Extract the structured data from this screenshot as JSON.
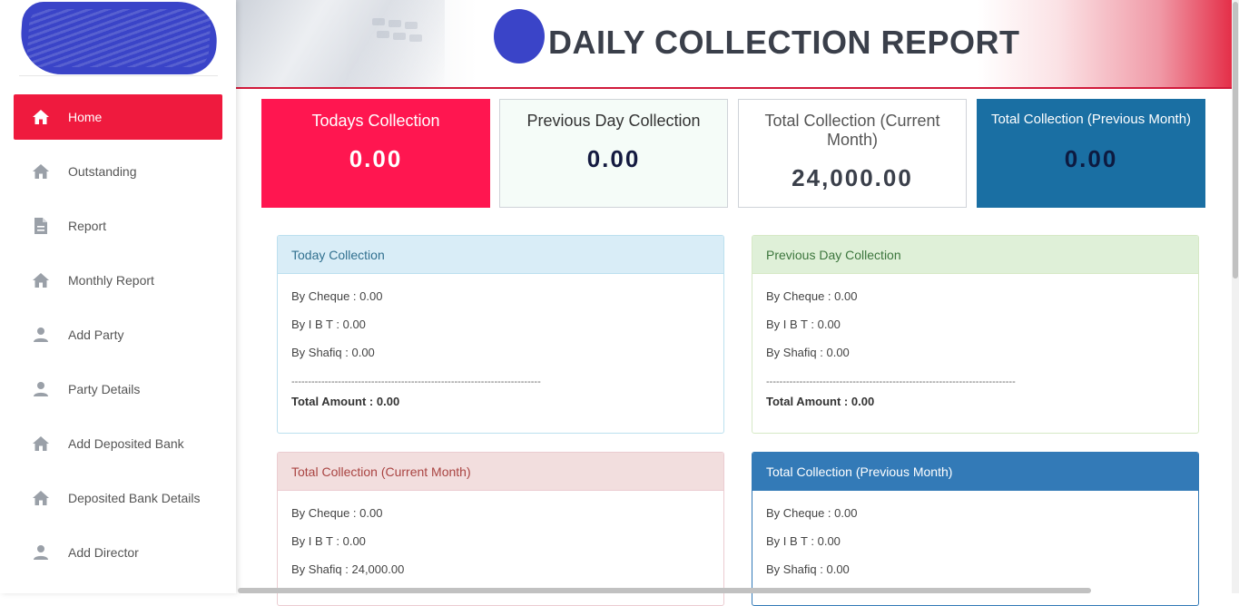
{
  "header": {
    "title": "DAILY COLLECTION REPORT"
  },
  "sidebar": {
    "items": [
      {
        "label": "Home",
        "icon": "home-icon",
        "active": true
      },
      {
        "label": "Outstanding",
        "icon": "home-icon"
      },
      {
        "label": "Report",
        "icon": "document-icon"
      },
      {
        "label": "Monthly Report",
        "icon": "home-icon"
      },
      {
        "label": "Add Party",
        "icon": "person-icon"
      },
      {
        "label": "Party Details",
        "icon": "person-icon"
      },
      {
        "label": "Add Deposited Bank",
        "icon": "home-icon"
      },
      {
        "label": "Deposited Bank Details",
        "icon": "home-icon"
      },
      {
        "label": "Add Director",
        "icon": "person-icon"
      }
    ]
  },
  "stats": [
    {
      "title": "Todays Collection",
      "value": "0.00",
      "color": "#ff1650"
    },
    {
      "title": "Previous Day Collection",
      "value": "0.00",
      "color": "#f5fcf8"
    },
    {
      "title": "Total Collection (Current Month)",
      "value": "24,000.00",
      "color": "#ffffff"
    },
    {
      "title": "Total Collection (Previous Month)",
      "value": "0.00",
      "color": "#1a6fa3"
    }
  ],
  "panels": [
    {
      "title": "Today Collection",
      "cheque": "By Cheque : 0.00",
      "ibt": "By I B T : 0.00",
      "shafiq": "By Shafiq : 0.00",
      "separator": "---------------------------------------------------------------------------",
      "total": "Total Amount : 0.00"
    },
    {
      "title": "Previous Day Collection",
      "cheque": "By Cheque : 0.00",
      "ibt": "By I B T : 0.00",
      "shafiq": "By Shafiq : 0.00",
      "separator": "---------------------------------------------------------------------------",
      "total": "Total Amount : 0.00"
    },
    {
      "title": "Total Collection (Current Month)",
      "cheque": "By Cheque : 0.00",
      "ibt": "By I B T : 0.00",
      "shafiq": "By Shafiq : 24,000.00"
    },
    {
      "title": "Total Collection (Previous Month)",
      "cheque": "By Cheque : 0.00",
      "ibt": "By I B T : 0.00",
      "shafiq": "By Shafiq : 0.00"
    }
  ]
}
